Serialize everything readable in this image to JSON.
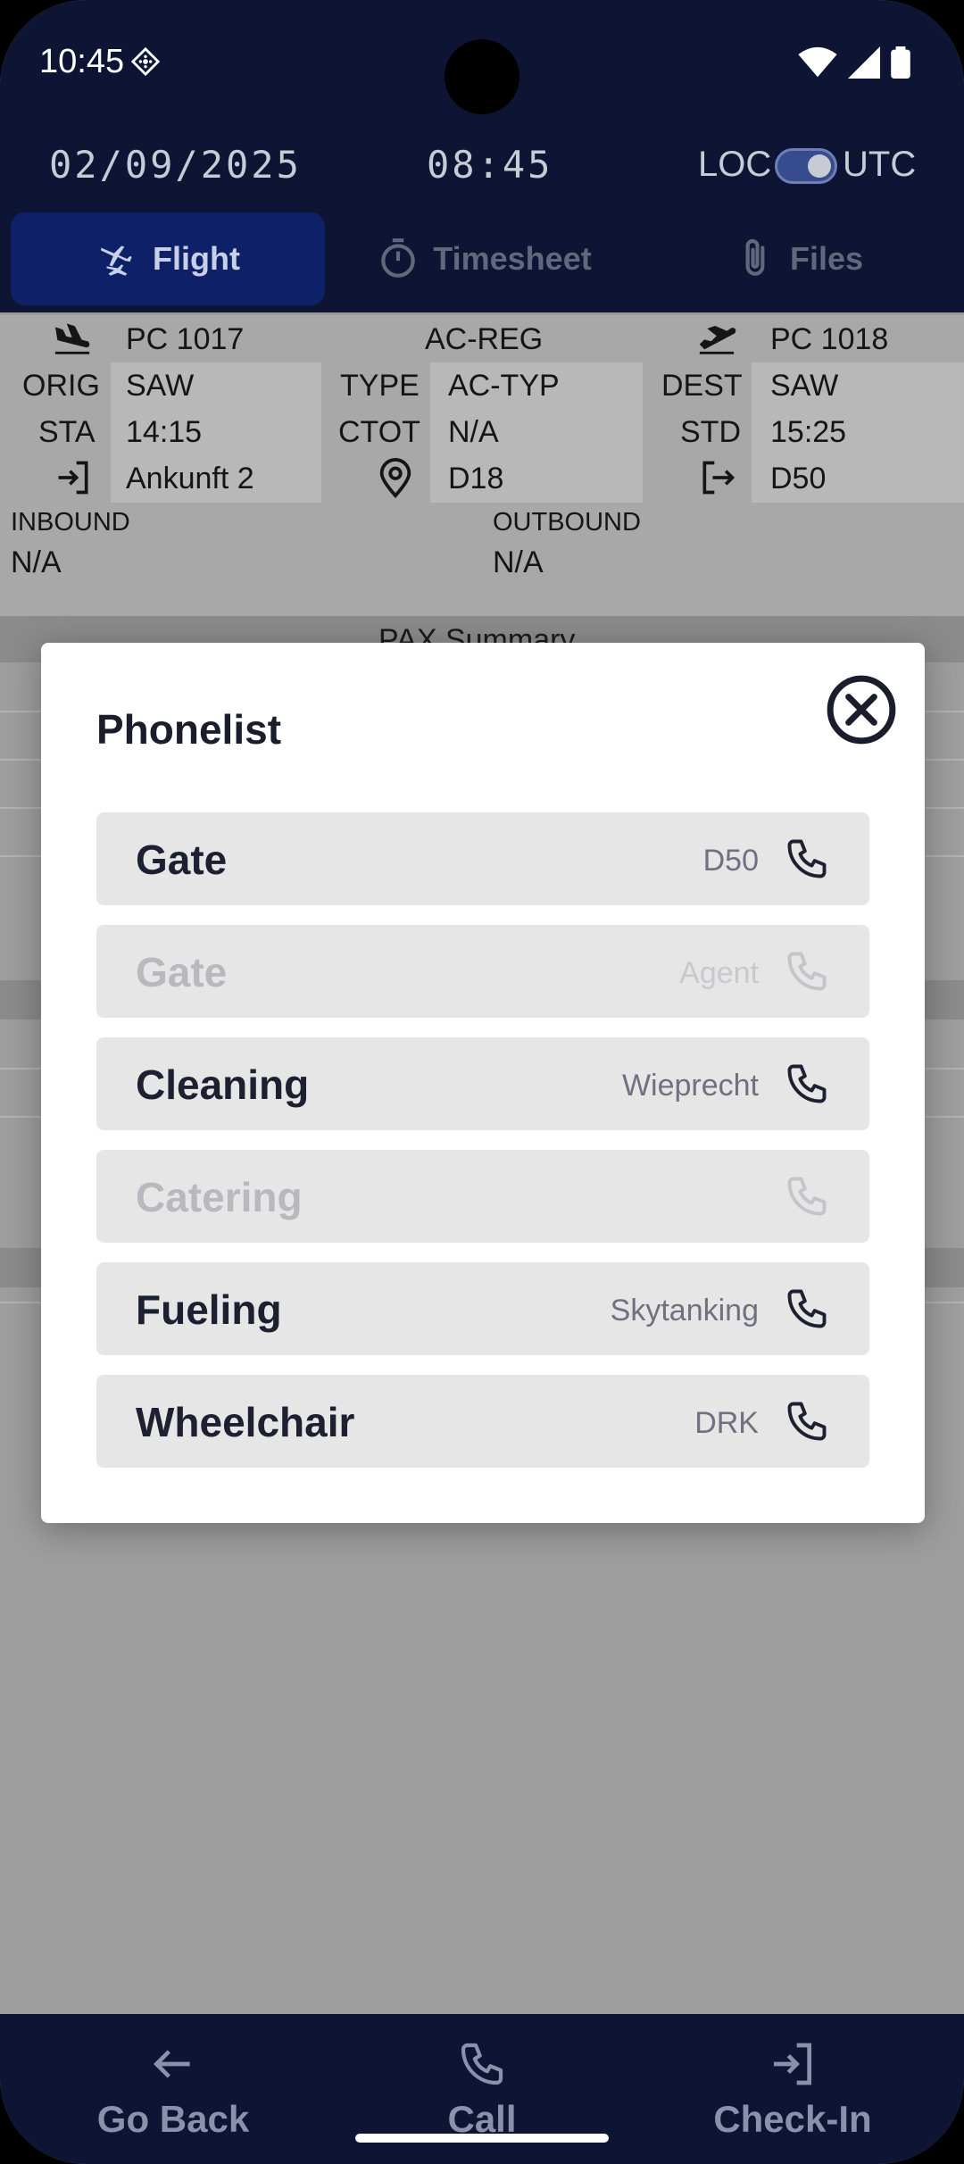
{
  "status": {
    "time": "10:45"
  },
  "header": {
    "date": "02/09/2025",
    "time": "08:45",
    "loc_label": "LOC",
    "utc_label": "UTC"
  },
  "tabs": [
    {
      "label": "Flight",
      "icon": "airplanes-icon",
      "active": true
    },
    {
      "label": "Timesheet",
      "icon": "stopwatch-icon",
      "active": false
    },
    {
      "label": "Files",
      "icon": "paperclip-icon",
      "active": false
    }
  ],
  "flight": {
    "arrival": {
      "flight": "PC 1017",
      "orig_label": "ORIG",
      "orig": "SAW",
      "sta_label": "STA",
      "sta": "14:15",
      "gate": "Ankunft 2"
    },
    "aircraft": {
      "reg": "AC-REG",
      "type_label": "TYPE",
      "type": "AC-TYP",
      "ctot_label": "CTOT",
      "ctot": "N/A",
      "stand": "D18"
    },
    "departure": {
      "flight": "PC 1018",
      "dest_label": "DEST",
      "dest": "SAW",
      "std_label": "STD",
      "std": "15:25",
      "gate": "D50"
    },
    "inbound_label": "INBOUND",
    "inbound": "N/A",
    "outbound_label": "OUTBOUND",
    "outbound": "N/A"
  },
  "section": {
    "pax_summary": "PAX Summary"
  },
  "modal": {
    "title": "Phonelist",
    "rows": [
      {
        "label": "Gate",
        "value": "D50",
        "enabled": true
      },
      {
        "label": "Gate",
        "value": "Agent",
        "enabled": false
      },
      {
        "label": "Cleaning",
        "value": "Wieprecht",
        "enabled": true
      },
      {
        "label": "Catering",
        "value": "",
        "enabled": false
      },
      {
        "label": "Fueling",
        "value": "Skytanking",
        "enabled": true
      },
      {
        "label": "Wheelchair",
        "value": "DRK",
        "enabled": true
      }
    ]
  },
  "bottom_nav": [
    {
      "label": "Go Back",
      "icon": "arrow-left-icon"
    },
    {
      "label": "Call",
      "icon": "phone-icon"
    },
    {
      "label": "Check-In",
      "icon": "login-icon"
    }
  ],
  "colors": {
    "nav_bg": "#0d1434",
    "active_tab": "#0e2168",
    "row_bg": "#e6e6e6"
  }
}
